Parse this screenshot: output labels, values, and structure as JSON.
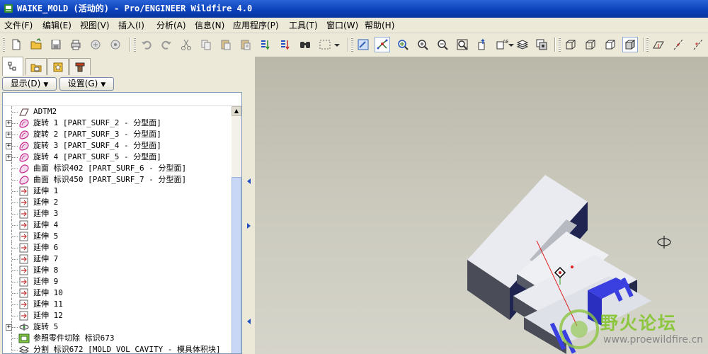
{
  "window": {
    "title": "WAIKE_MOLD (活动的) - Pro/ENGINEER Wildfire 4.0"
  },
  "menu": [
    {
      "label": "文件(F)"
    },
    {
      "label": "编辑(E)"
    },
    {
      "label": "视图(V)"
    },
    {
      "label": "插入(I)"
    },
    {
      "label": "分析(A)"
    },
    {
      "label": "信息(N)"
    },
    {
      "label": "应用程序(P)"
    },
    {
      "label": "工具(T)"
    },
    {
      "label": "窗口(W)"
    },
    {
      "label": "帮助(H)"
    }
  ],
  "toolbar_icons": [
    "new-file-icon",
    "open-folder-icon",
    "save-icon",
    "print-icon",
    "email-icon",
    "email-link-icon",
    "undo-icon",
    "redo-icon",
    "cut-icon",
    "copy-icon",
    "paste-icon",
    "paste-special-icon",
    "regenerate-icon",
    "regenerate-manager-icon",
    "find-icon",
    "select-box-icon",
    "repaint-icon",
    "spin-center-icon",
    "orient-mode-icon",
    "zoom-in-icon",
    "zoom-out-icon",
    "refit-icon",
    "reorient-icon",
    "saved-views-icon",
    "layers-icon",
    "view-manager-icon",
    "wireframe-icon",
    "hidden-line-icon",
    "no-hidden-icon",
    "shading-icon",
    "datum-plane-icon",
    "datum-axis-icon",
    "datum-point-icon"
  ],
  "navigator": {
    "tabs": [
      "model-tree-icon",
      "folder-browser-icon",
      "favorites-icon",
      "connections-icon"
    ],
    "show_button": "显示(D)",
    "settings_button": "设置(G)"
  },
  "tree": [
    {
      "label": "ADTM2",
      "icon": "datum-plane-icon",
      "expandable": false
    },
    {
      "label": "旋转 1 [PART_SURF_2 - 分型面]",
      "icon": "revolve-surface-icon",
      "expandable": true
    },
    {
      "label": "旋转 2 [PART_SURF_3 - 分型面]",
      "icon": "revolve-surface-icon",
      "expandable": true
    },
    {
      "label": "旋转 3 [PART_SURF_4 - 分型面]",
      "icon": "revolve-surface-icon",
      "expandable": true
    },
    {
      "label": "旋转 4 [PART_SURF_5 - 分型面]",
      "icon": "revolve-surface-icon",
      "expandable": true
    },
    {
      "label": "曲面 标识402 [PART_SURF_6 - 分型面]",
      "icon": "surface-icon",
      "expandable": false
    },
    {
      "label": "曲面 标识450 [PART_SURF_7 - 分型面]",
      "icon": "surface-icon",
      "expandable": false
    },
    {
      "label": "延伸 1",
      "icon": "extend-icon",
      "expandable": false
    },
    {
      "label": "延伸 2",
      "icon": "extend-icon",
      "expandable": false
    },
    {
      "label": "延伸 3",
      "icon": "extend-icon",
      "expandable": false
    },
    {
      "label": "延伸 4",
      "icon": "extend-icon",
      "expandable": false
    },
    {
      "label": "延伸 5",
      "icon": "extend-icon",
      "expandable": false
    },
    {
      "label": "延伸 6",
      "icon": "extend-icon",
      "expandable": false
    },
    {
      "label": "延伸 7",
      "icon": "extend-icon",
      "expandable": false
    },
    {
      "label": "延伸 8",
      "icon": "extend-icon",
      "expandable": false
    },
    {
      "label": "延伸 9",
      "icon": "extend-icon",
      "expandable": false
    },
    {
      "label": "延伸 10",
      "icon": "extend-icon",
      "expandable": false
    },
    {
      "label": "延伸 11",
      "icon": "extend-icon",
      "expandable": false
    },
    {
      "label": "延伸 12",
      "icon": "extend-icon",
      "expandable": false
    },
    {
      "label": "旋转 5",
      "icon": "revolve-icon",
      "expandable": true
    },
    {
      "label": "参照零件切除 标识673",
      "icon": "reference-part-cutout-icon",
      "expandable": false
    },
    {
      "label": "分割 标识672 [MOLD_VOL_CAVITY - 模具体积块]",
      "icon": "split-icon",
      "expandable": false
    }
  ],
  "watermark": {
    "title": "野火论坛",
    "url": "www.proewildfire.cn"
  },
  "colors": {
    "title_bar": "#0a3fb8",
    "viewport_bg": "#c9c8bb",
    "surface_icon": "#c0288c",
    "mold_block": "#e9ebf0"
  }
}
